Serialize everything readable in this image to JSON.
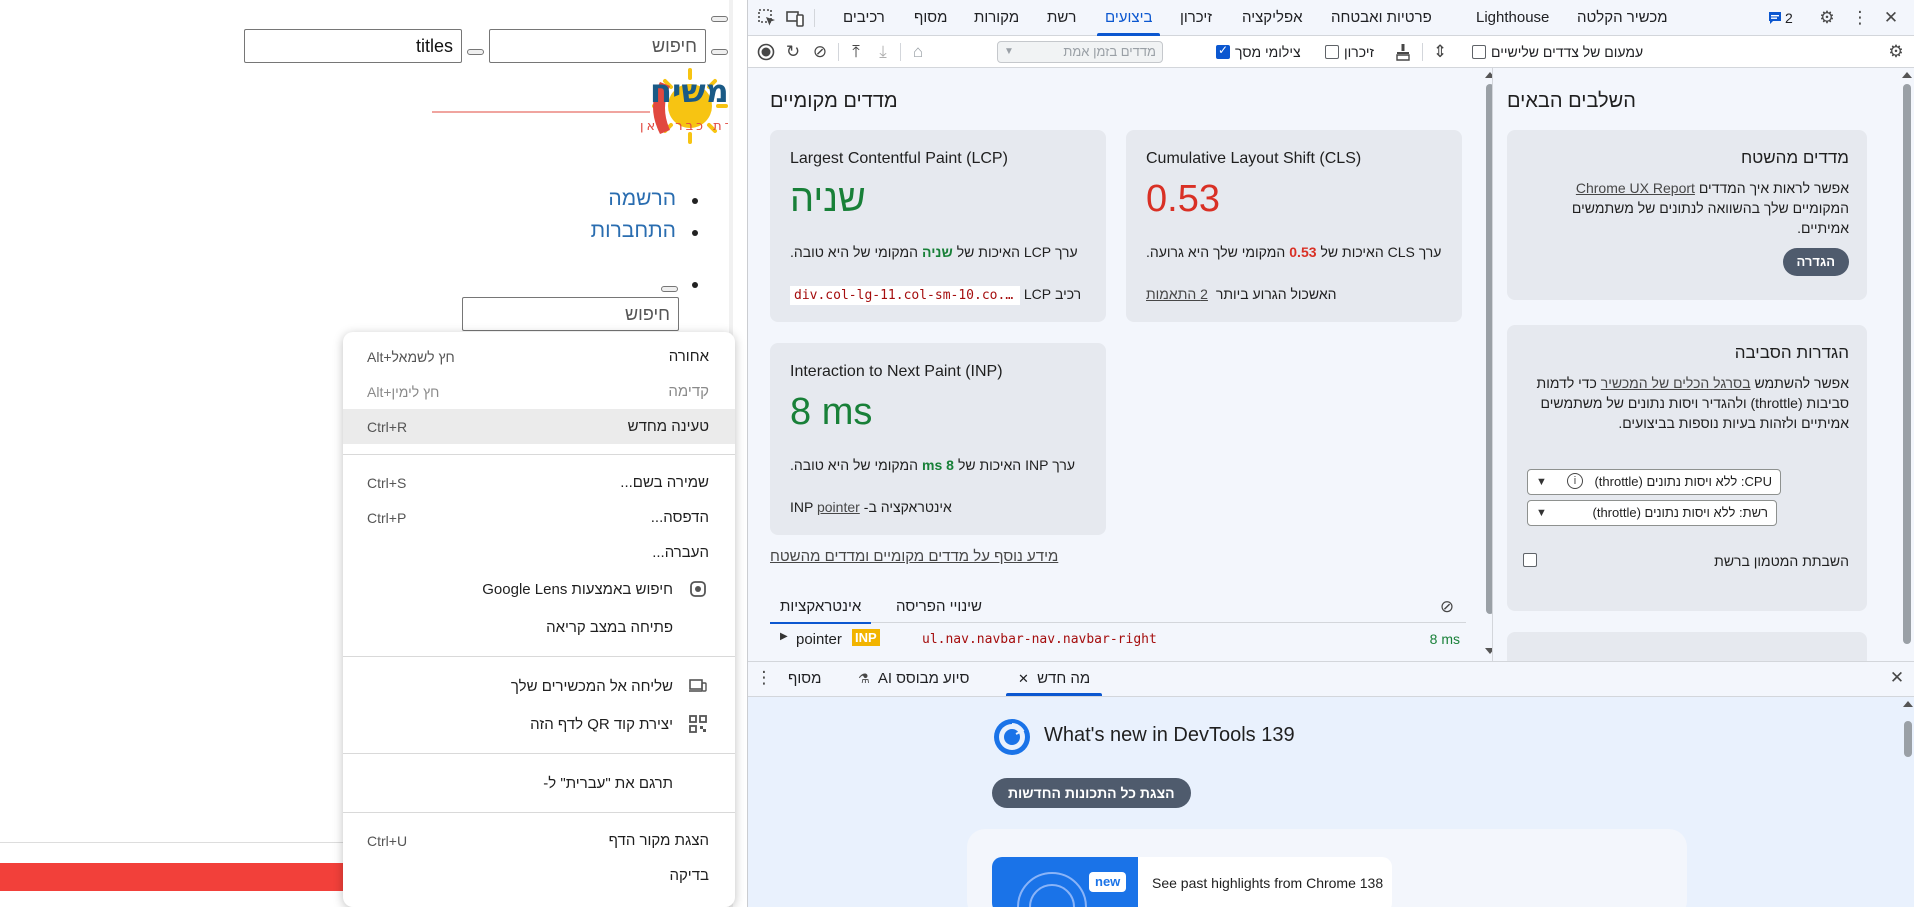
{
  "webpage": {
    "titles_input_value": "titles",
    "search_placeholder": "חיפוש",
    "nav_items": [
      "הרשמה",
      "התחברות"
    ],
    "search2_placeholder": "חיפוש",
    "logo_text": "ימות המשיח",
    "logo_tagline": "עתיד התקשורת כבר כאן"
  },
  "context_menu": {
    "items": [
      {
        "label": "אחורה",
        "shortcut": "Alt+חץ לשמאל"
      },
      {
        "label": "קדימה",
        "shortcut": "Alt+חץ לימין"
      },
      {
        "label": "טעינה מחדש",
        "shortcut": "Ctrl+R"
      },
      {
        "label": "שמירה בשם...",
        "shortcut": "Ctrl+S"
      },
      {
        "label": "הדפסה...",
        "shortcut": "Ctrl+P"
      },
      {
        "label": "העברה...",
        "shortcut": ""
      },
      {
        "label": "חיפוש באמצעות Google Lens",
        "shortcut": ""
      },
      {
        "label": "פתיחה במצב קריאה",
        "shortcut": ""
      },
      {
        "label": "שליחה אל המכשירים שלך",
        "shortcut": ""
      },
      {
        "label": "יצירת קוד QR לדף הזה",
        "shortcut": ""
      },
      {
        "label": "תרגם את \"עברית\" ל-",
        "shortcut": ""
      },
      {
        "label": "הצגת מקור הדף",
        "shortcut": "Ctrl+U"
      },
      {
        "label": "בדיקה",
        "shortcut": ""
      }
    ]
  },
  "devtools": {
    "tabs": {
      "recorder": "מכשיר הקלטה",
      "lighthouse": "Lighthouse",
      "privacy": "פרטיות ואבטחה",
      "application": "אפליקציה",
      "memory": "זיכרון",
      "performance": "ביצועים",
      "network": "רשת",
      "sources": "מקורות",
      "more": "מסוף",
      "elements": "רכיבים"
    },
    "issues_count": "2",
    "toolbar": {
      "third_party": "עמעום של צדדים שלישיים",
      "memory": "זיכרון",
      "screenshots": "צילומי מסך",
      "throttle_placeholder": "מדדים בזמן אמת"
    },
    "local_metrics": {
      "title": "מדדים מקומיים",
      "lcp": {
        "title": "Largest Contentful Paint (LCP)",
        "value": "שניה",
        "desc_pre": "ערך LCP האיכות של",
        "desc_val": "שניה",
        "desc_post": "המקומי של היא טובה.",
        "foot_label": "רכיב LCP",
        "foot_code": "div.col-lg-11.col-sm-10.co..."
      },
      "cls": {
        "title": "Cumulative Layout Shift (CLS)",
        "value": "0.53",
        "desc_pre": "ערך CLS האיכות של",
        "desc_val": "0.53",
        "desc_post": "המקומי שלך היא גרועה.",
        "foot_label": "האשכול הגרוע ביותר",
        "foot_link": "2 התאמות"
      },
      "inp": {
        "title": "Interaction to Next Paint (INP)",
        "value": "8 ms",
        "desc_pre": "ערך INP האיכות של",
        "desc_val": "8 ms",
        "desc_post": "המקומי של היא טובה.",
        "foot_label": "אינטראקציה ב-INP",
        "foot_link": "pointer"
      },
      "more_info": "מידע נוסף על מדדים מקומיים ומדדים מהשטח"
    },
    "interactions": {
      "tab_interactions": "אינטראקציות",
      "tab_layout": "שינויי הפריסה",
      "row": {
        "type": "pointer",
        "badge": "INP",
        "selector": "ul.nav.navbar-nav.navbar-right",
        "duration": "8 ms"
      }
    },
    "next_steps": {
      "title": "השלבים הבאים",
      "field": {
        "title": "מדדים מהשטח",
        "text_pre": "אפשר לראות איך המדדים",
        "link": "Chrome UX Report",
        "text_post": "המקומיים שלך בהשוואה לנתונים של משתמשים אמיתיים.",
        "button": "הגדרה"
      },
      "env": {
        "title": "הגדרות הסביבה",
        "text_pre": "אפשר להשתמש",
        "link": "בסרגל הכלים של המכשיר",
        "text_post": "כדי לדמות סביבות (throttle) ולהגדיר ויסות נתונים של משתמשים אמיתיים ולזהות בעיות נוספות בביצועים.",
        "cpu_select": "CPU: ללא ויסות נתונים (throttle)",
        "network_select": "רשת: ללא ויסות נתונים (throttle)",
        "disable_cache": "השבתת המטמון ברשת"
      }
    },
    "drawer": {
      "tab_whatsnew": "מה חדש",
      "tab_ai": "סיוע מבוסס AI",
      "tab_console": "מסוף",
      "whatsnew_title": "What's new in DevTools 139",
      "show_all": "הצגת כל התכונות החדשות",
      "new_badge": "new",
      "highlight_text": "See past highlights from Chrome 138"
    }
  }
}
